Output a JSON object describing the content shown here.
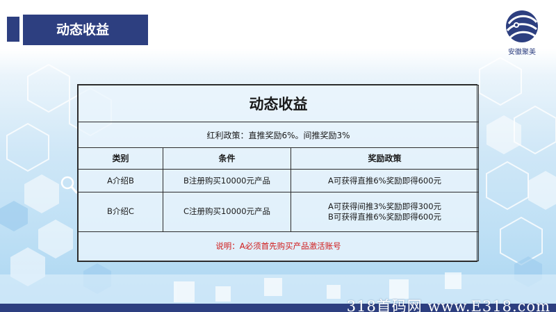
{
  "slide": {
    "header_title": "动态收益",
    "logo_text": "安徽聚美"
  },
  "table": {
    "title": "动态收益",
    "policy": "红利政策：直推奖励6%。间推奖励3%",
    "headers": [
      "类别",
      "条件",
      "奖励政策"
    ],
    "rows": [
      {
        "category": "A介绍B",
        "condition": "B注册购买10000元产品",
        "reward": [
          "A可获得直推6%奖励即得600元"
        ]
      },
      {
        "category": "B介绍C",
        "condition": "C注册购买10000元产品",
        "reward": [
          "A可获得间推3%奖励即得300元",
          "B可获得直推6%奖励即得600元"
        ]
      }
    ],
    "note": "说明：A必须首先购买产品激活账号"
  },
  "watermark": "318首码网 www.E318.com",
  "colors": {
    "header_navy": "#2d3f80",
    "note_red": "#d01a1a",
    "bg_light_blue": "#cfe7f7"
  },
  "icons": [
    "magnifier-icon",
    "company-logo"
  ]
}
